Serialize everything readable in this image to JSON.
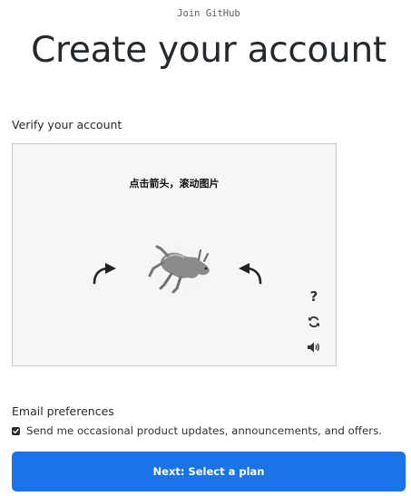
{
  "header": {
    "join_label": "Join GitHub",
    "title": "Create your account"
  },
  "verify": {
    "label": "Verify your account",
    "captcha": {
      "instruction": "点击箭头，滚动图片",
      "left_arrow_icon": "rotate-left-arrow-icon",
      "right_arrow_icon": "rotate-right-arrow-icon",
      "image": "animal-figure-image",
      "help_label": "?",
      "refresh_icon": "refresh-icon",
      "audio_icon": "speaker-icon"
    }
  },
  "email_preferences": {
    "label": "Email preferences",
    "checkbox_checked": true,
    "checkbox_label": "Send me occasional product updates, announcements, and offers."
  },
  "next_button": {
    "label": "Next: Select a plan",
    "color": "#1b73e8"
  }
}
